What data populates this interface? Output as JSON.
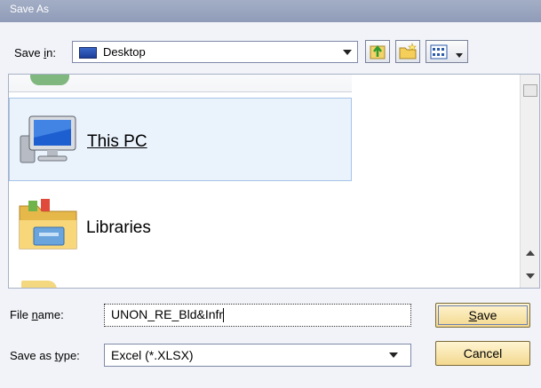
{
  "window": {
    "title": "Save As"
  },
  "save_in": {
    "label_pre": "Save ",
    "label_accel": "i",
    "label_post": "n:",
    "value": "Desktop"
  },
  "items": [
    {
      "label": "This PC",
      "icon": "computer-icon",
      "selected": true
    },
    {
      "label": "Libraries",
      "icon": "folder-icon"
    }
  ],
  "file_name": {
    "label_pre": "File ",
    "label_accel": "n",
    "label_post": "ame:",
    "value": "UNON_RE_Bld&Infr"
  },
  "save_type": {
    "label_pre": "Save as ",
    "label_accel": "t",
    "label_post": "ype:",
    "value": "Excel (*.XLSX)"
  },
  "buttons": {
    "save_accel": "S",
    "save_rest": "ave",
    "cancel": "Cancel"
  }
}
